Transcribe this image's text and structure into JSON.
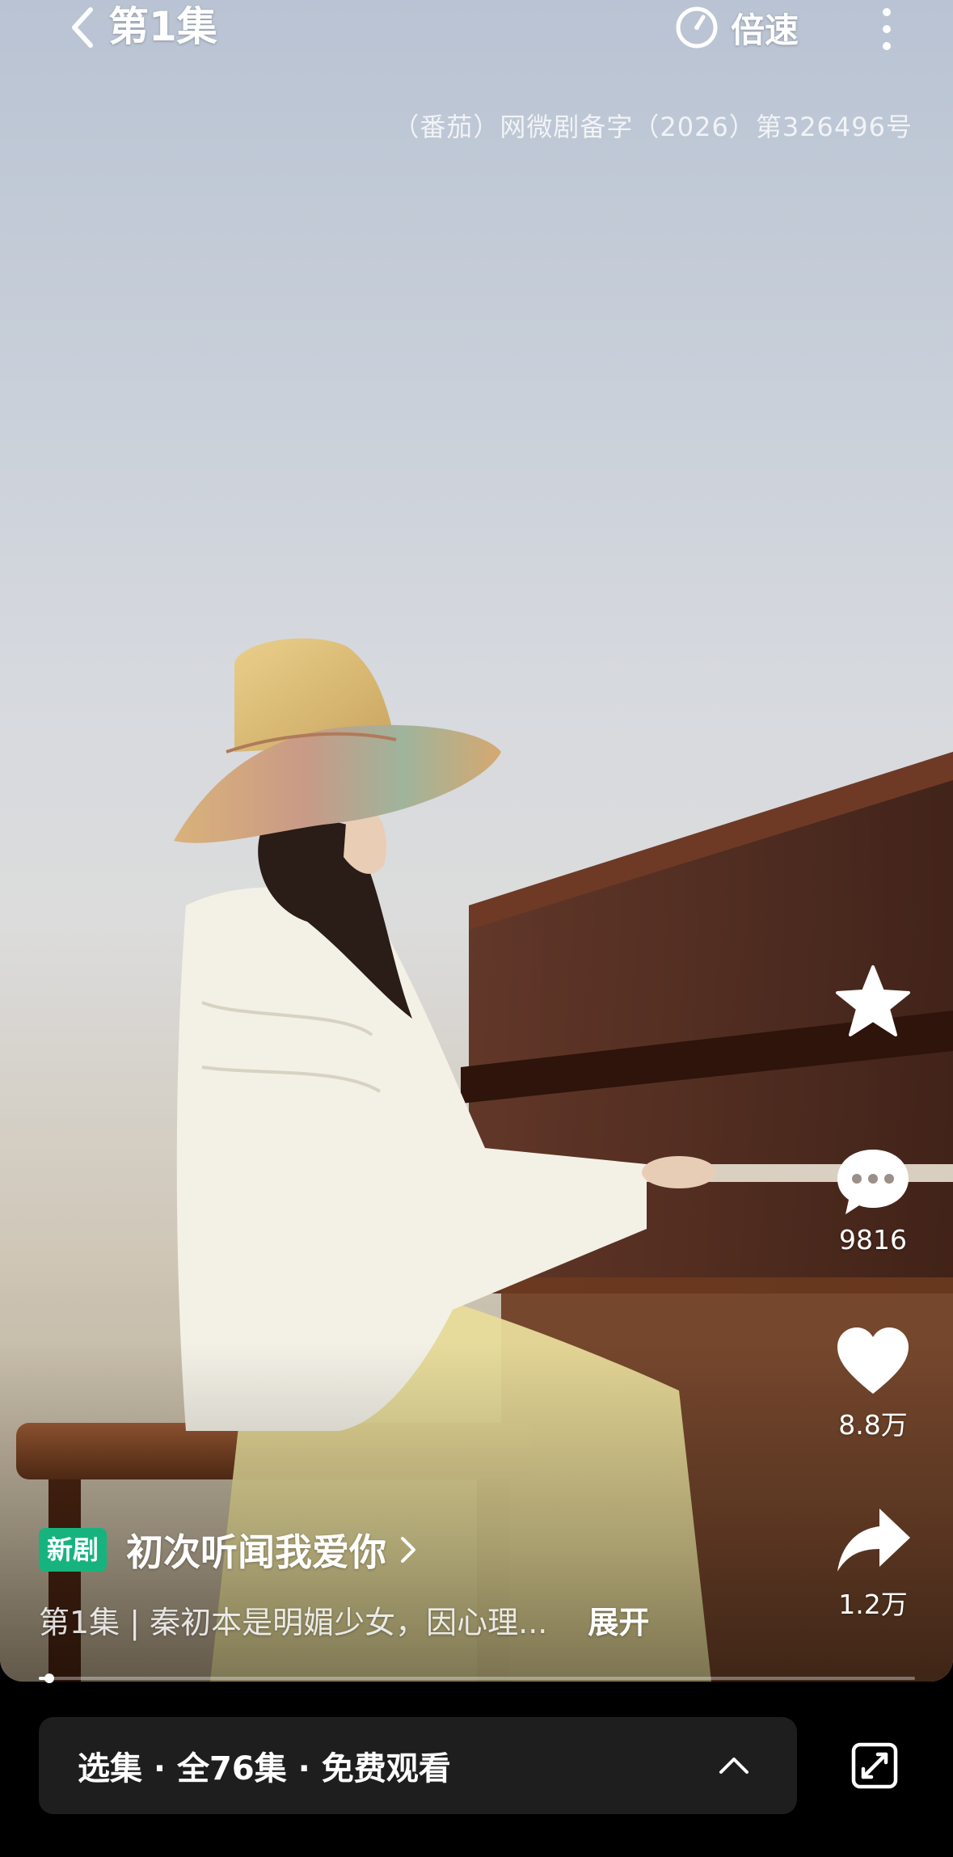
{
  "header": {
    "title": "第1集",
    "speed_label": "倍速",
    "license": "（番茄）网微剧备字（2026）第326496号"
  },
  "actions": {
    "comments_count": "9816",
    "likes_count": "8.8万",
    "shares_count": "1.2万"
  },
  "info": {
    "badge": "新剧",
    "drama_title": "初次听闻我爱你",
    "description": "第1集 | 秦初本是明媚少女，因心理...",
    "expand_label": "展开"
  },
  "progress": {
    "fraction": 0.012
  },
  "episode_bar": {
    "label": "选集 · 全76集 · 免费观看"
  },
  "colors": {
    "badge": "#17b37e",
    "bar_bg": "#1e1e1f",
    "page_bg": "#000000"
  },
  "icons": [
    "back-chevron-icon",
    "timer-icon",
    "more-dots-icon",
    "star-icon",
    "comment-icon",
    "heart-icon",
    "share-icon",
    "chevron-right-icon",
    "chevron-up-icon",
    "screen-rotate-icon"
  ]
}
